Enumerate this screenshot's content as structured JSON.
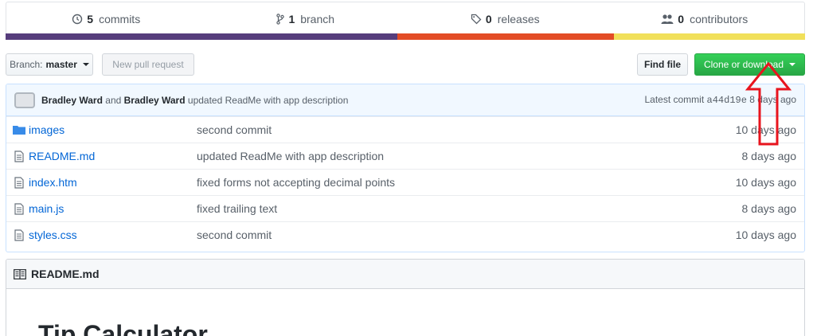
{
  "summary": {
    "commits": {
      "count": "5",
      "label": "commits"
    },
    "branches": {
      "count": "1",
      "label": "branch"
    },
    "releases": {
      "count": "0",
      "label": "releases"
    },
    "contributors": {
      "count": "0",
      "label": "contributors"
    }
  },
  "language_colors": [
    "#563d7c",
    "#e34c26",
    "#f1e05a"
  ],
  "language_shares": [
    0.492,
    0.27,
    0.238
  ],
  "toolbar": {
    "branch_prefix": "Branch:",
    "branch_name": "master",
    "new_pull_request": "New pull request",
    "find_file": "Find file",
    "clone_download": "Clone or download"
  },
  "commit_tease": {
    "author1": "Bradley Ward",
    "and": "and",
    "author2": "Bradley Ward",
    "message": "updated ReadMe with app description",
    "latest_label": "Latest commit",
    "sha": "a44d19e",
    "age": "8 days ago"
  },
  "files": [
    {
      "name": "images",
      "type": "folder-icon",
      "message": "second commit",
      "age": "10 days ago"
    },
    {
      "name": "README.md",
      "type": "file-icon",
      "message": "updated ReadMe with app description",
      "age": "8 days ago"
    },
    {
      "name": "index.htm",
      "type": "file-icon",
      "message": "fixed forms not accepting decimal points",
      "age": "10 days ago"
    },
    {
      "name": "main.js",
      "type": "file-icon",
      "message": "fixed trailing text",
      "age": "8 days ago"
    },
    {
      "name": "styles.css",
      "type": "file-icon",
      "message": "second commit",
      "age": "10 days ago"
    }
  ],
  "readme": {
    "header": "README.md",
    "title": "Tip Calculator"
  },
  "accent": {
    "green": "#28a745",
    "link": "#0366d6",
    "annotation": "#e8141e"
  }
}
